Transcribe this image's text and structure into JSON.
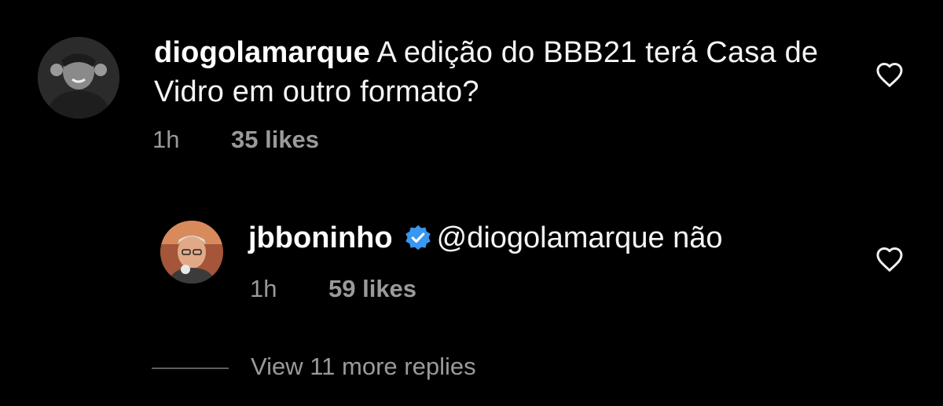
{
  "comment": {
    "username": "diogolamarque",
    "text": "A edição do BBB21 terá Casa de Vidro em outro formato?",
    "time": "1h",
    "likes": "35 likes",
    "like_icon": "heart-outline-icon"
  },
  "reply": {
    "username": "jbboninho",
    "verified_icon": "verified-badge-icon",
    "text": "@diogolamarque não",
    "time": "1h",
    "likes": "59 likes",
    "like_icon": "heart-outline-icon"
  },
  "view_replies": {
    "label": "View 11 more replies"
  },
  "colors": {
    "background": "#000000",
    "text": "#f5f5f5",
    "muted": "#9a9a9a",
    "verified": "#3897f0"
  }
}
